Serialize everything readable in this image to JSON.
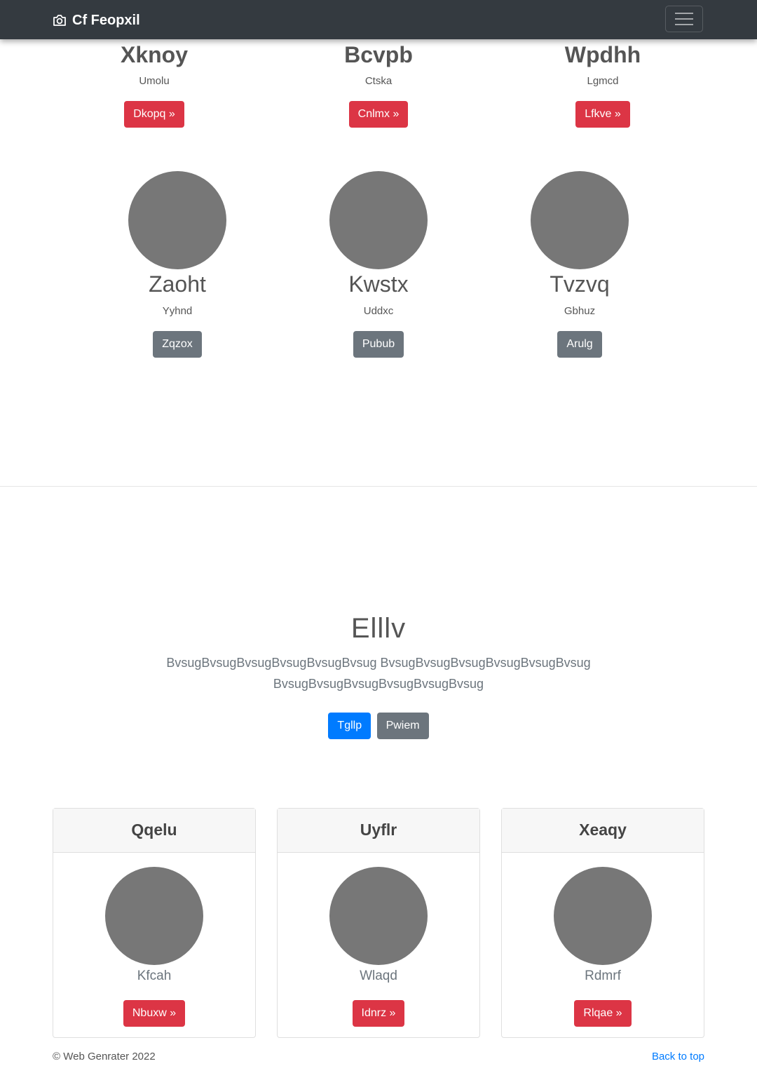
{
  "navbar": {
    "brand": "Cf Feopxil",
    "brand_icon": "camera-icon",
    "menu_icon": "hamburger-icon"
  },
  "top_row": [
    {
      "name": "Xknoy",
      "subtitle": "Umolu",
      "button": "Dkopq »"
    },
    {
      "name": "Bcvpb",
      "subtitle": "Ctska",
      "button": "Cnlmx »"
    },
    {
      "name": "Wpdhh",
      "subtitle": "Lgmcd",
      "button": "Lfkve »"
    }
  ],
  "second_row": [
    {
      "name": "Zaoht",
      "subtitle": "Yyhnd",
      "button": "Zqzox"
    },
    {
      "name": "Kwstx",
      "subtitle": "Uddxc",
      "button": "Pubub"
    },
    {
      "name": "Tvzvq",
      "subtitle": "Gbhuz",
      "button": "Arulg"
    }
  ],
  "hero": {
    "title": "Elllv",
    "lead": "BvsugBvsugBvsugBvsugBvsugBvsug BvsugBvsugBvsugBvsugBvsugBvsug BvsugBvsugBvsugBvsugBvsugBvsug",
    "primary_button": "Tgllp",
    "secondary_button": "Pwiem"
  },
  "cards": [
    {
      "header": "Qqelu",
      "subtitle": "Kfcah",
      "button": "Nbuxw »"
    },
    {
      "header": "Uyflr",
      "subtitle": "Wlaqd",
      "button": "Idnrz »"
    },
    {
      "header": "Xeaqy",
      "subtitle": "Rdmrf",
      "button": "Rlqae »"
    }
  ],
  "footer": {
    "copyright": "© Web Genrater 2022",
    "back_to_top": "Back to top"
  },
  "colors": {
    "navbar": "#343a40",
    "danger": "#dc3545",
    "secondary": "#6c757d",
    "primary": "#007bff",
    "avatar": "#777777"
  }
}
